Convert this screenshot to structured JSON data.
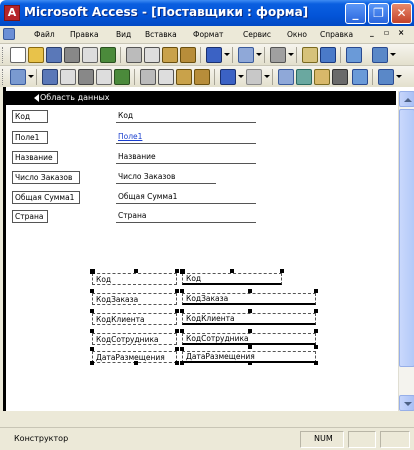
{
  "window": {
    "title": "Microsoft Access - [Поставщики : форма]"
  },
  "title_buttons": {
    "minimize": "_",
    "restore": "❐",
    "close": "✕"
  },
  "menu": {
    "items": [
      "Файл",
      "Правка",
      "Вид",
      "Вставка",
      "Формат",
      "Сервис",
      "Окно",
      "Справка"
    ],
    "doc_controls": [
      "_",
      "▫",
      "×"
    ]
  },
  "section": {
    "label": "Область данных"
  },
  "form_fields": [
    {
      "label": "Код",
      "value": "Код",
      "link": false
    },
    {
      "label": "Поле1",
      "value": "Поле1",
      "link": true
    },
    {
      "label": "Название",
      "value": "Название",
      "link": false
    },
    {
      "label": "Число Заказов",
      "value": "Число Заказов",
      "link": false
    },
    {
      "label": "Общая Сумма1",
      "value": "Общая Сумма1",
      "link": false
    },
    {
      "label": "Страна",
      "value": "Страна",
      "link": false
    }
  ],
  "subform_fields": [
    {
      "label": "Код",
      "value": "Код"
    },
    {
      "label": "КодЗаказа",
      "value": "КодЗаказа"
    },
    {
      "label": "КодКлиента",
      "value": "КодКлиента"
    },
    {
      "label": "КодСотрудника",
      "value": "КодСотрудника"
    },
    {
      "label": "ДатаРазмещения",
      "value": "ДатаРазмещения"
    }
  ],
  "status": {
    "mode": "Конструктор",
    "indicator": "NUM"
  },
  "colors": {
    "title_bar": "#0354d8",
    "chrome": "#ece9d8",
    "link": "#1a3fcf"
  }
}
